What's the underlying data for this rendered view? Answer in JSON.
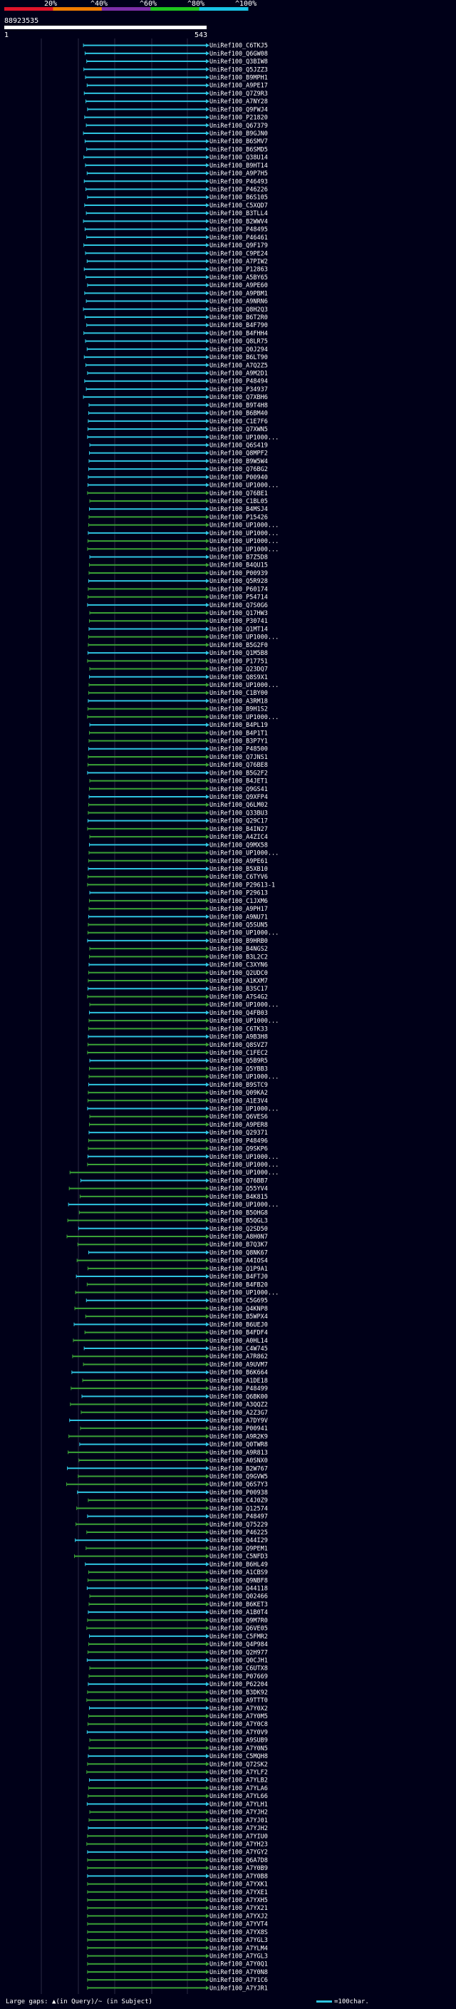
{
  "header": {
    "ruler_ticks": [
      "20%",
      "^40%",
      "^60%",
      "^80%",
      "^100%"
    ],
    "ruler_colors": [
      "#e0142a",
      "#f07b00",
      "#7d2fa8",
      "#1ec41e",
      "#18c3e6"
    ],
    "query_id": "88923535",
    "start_pos": "1",
    "end_pos": "543"
  },
  "colors": {
    "background": "#000018",
    "match_cyan": "#2ec4e0",
    "match_green": "#3aa236",
    "grid": "#2a2a44"
  },
  "footer": {
    "left_text": "Large gaps: ▲(in Query)/~ (in Subject)",
    "right_text": "=100char."
  },
  "chart_data": {
    "type": "alignment",
    "query_length": 543,
    "labels": [
      "UniRef100_C6TKJ5",
      "UniRef100_Q6GW08",
      "UniRef100_Q3BIW8",
      "UniRef100_Q5JZZ3",
      "UniRef100_B9MPH1",
      "UniRef100_A9PE17",
      "UniRef100_Q7Z9R3",
      "UniRef100_A7NY28",
      "UniRef100_Q9FWJ4",
      "UniRef100_P21820",
      "UniRef100_Q67379",
      "UniRef100_B9GJN0",
      "UniRef100_B6SMV7",
      "UniRef100_B6SMD5",
      "UniRef100_Q38U14",
      "UniRef100_B9HT14",
      "UniRef100_A9P7H5",
      "UniRef100_P46493",
      "UniRef100_P46226",
      "UniRef100_B6S105",
      "UniRef100_C5XQD7",
      "UniRef100_B3TLL4",
      "UniRef100_B2WWV4",
      "UniRef100_P48495",
      "UniRef100_P46461",
      "UniRef100_Q9F179",
      "UniRef100_C9PE24",
      "UniRef100_A7PIW2",
      "UniRef100_P12863",
      "UniRef100_A5BY65",
      "UniRef100_A9PE60",
      "UniRef100_A9PBM1",
      "UniRef100_A9NRN6",
      "UniRef100_Q8H2Q3",
      "UniRef100_B6T2R0",
      "UniRef100_B4F790",
      "UniRef100_B4FHH4",
      "UniRef100_Q8LR75",
      "UniRef100_Q0J294",
      "UniRef100_B6LT90",
      "UniRef100_A7Q2Z5",
      "UniRef100_A9M2D1",
      "UniRef100_P48494",
      "UniRef100_P34937",
      "UniRef100_Q7XBH6",
      "UniRef100_B9T4H8",
      "UniRef100_B6BM40",
      "UniRef100_C1E7F6",
      "UniRef100_Q7XWN5",
      "UniRef100_UP1000...",
      "UniRef100_Q6S419",
      "UniRef100_Q8MPF2",
      "UniRef100_B9W5W4",
      "UniRef100_Q76BG2",
      "UniRef100_P00940",
      "UniRef100_UP1000...",
      "UniRef100_Q76BE1",
      "UniRef100_C1BL05",
      "UniRef100_B4MSJ4",
      "UniRef100_P15426",
      "UniRef100_UP1000...",
      "UniRef100_UP1000...",
      "UniRef100_UP1000...",
      "UniRef100_UP1000...",
      "UniRef100_B7Z5D8",
      "UniRef100_B4QU15",
      "UniRef100_P00939",
      "UniRef100_Q5R928",
      "UniRef100_P60174",
      "UniRef100_P54714",
      "UniRef100_Q7S0G6",
      "UniRef100_Q17HW3",
      "UniRef100_P30741",
      "UniRef100_Q1MT14",
      "UniRef100_UP1000...",
      "UniRef100_B5G2F0",
      "UniRef100_Q1M5B8",
      "UniRef100_P17751",
      "UniRef100_Q23DQ7",
      "UniRef100_Q8S9X1",
      "UniRef100_UP1000...",
      "UniRef100_C1BY00",
      "UniRef100_A3RM18",
      "UniRef100_B9H1S2",
      "UniRef100_UP1000...",
      "UniRef100_B4PL19",
      "UniRef100_B4P1T1",
      "UniRef100_B3P7Y1",
      "UniRef100_P48500",
      "UniRef100_Q7JNS1",
      "UniRef100_Q76BE8",
      "UniRef100_B5G2F2",
      "UniRef100_B4JET1",
      "UniRef100_Q9GS41",
      "UniRef100_Q9XFP4",
      "UniRef100_Q6LM02",
      "UniRef100_Q33BU3",
      "UniRef100_Q29C17",
      "UniRef100_B4IN27",
      "UniRef100_A4ZIC4",
      "UniRef100_Q9MX58",
      "UniRef100_UP1000...",
      "UniRef100_A9PE61",
      "UniRef100_B5XB10",
      "UniRef100_C6TYV6",
      "UniRef100_P29613-1",
      "UniRef100_P29613",
      "UniRef100_C1JXM6",
      "UniRef100_A9PH17",
      "UniRef100_A9NU71",
      "UniRef100_Q5SUN5",
      "UniRef100_UP1000...",
      "UniRef100_B9HRB0",
      "UniRef100_B4NGS2",
      "UniRef100_B3L2C2",
      "UniRef100_C3XYN6",
      "UniRef100_Q2UDC0",
      "UniRef100_A1KXM7",
      "UniRef100_B3SC17",
      "UniRef100_A7S4G2",
      "UniRef100_UP1000...",
      "UniRef100_Q4FB03",
      "UniRef100_UP1000...",
      "UniRef100_C6TK33",
      "UniRef100_A9B3H8",
      "UniRef100_Q8SVZ7",
      "UniRef100_C1FEC2",
      "UniRef100_Q5B9R5",
      "UniRef100_Q5YBB3",
      "UniRef100_UP1000...",
      "UniRef100_B9STC9",
      "UniRef100_Q09KA2",
      "UniRef100_A1E3V4",
      "UniRef100_UP1000...",
      "UniRef100_Q6VES6",
      "UniRef100_A9PER8",
      "UniRef100_Q29371",
      "UniRef100_P48496",
      "UniRef100_Q9SKP6",
      "UniRef100_UP1000...",
      "UniRef100_UP1000...",
      "UniRef100_UP1000...",
      "UniRef100_Q76BB7",
      "UniRef100_Q55YV4",
      "UniRef100_B4K815",
      "UniRef100_UP1000...",
      "UniRef100_B5OHG8",
      "UniRef100_B5QGL3",
      "UniRef100_Q2SD50",
      "UniRef100_A8H0N7",
      "UniRef100_B7Q3K7",
      "UniRef100_Q8NK67",
      "UniRef100_A4IOS4",
      "UniRef100_Q1P9A1",
      "UniRef100_B4FTJ0",
      "UniRef100_B4FB20",
      "UniRef100_UP1000...",
      "UniRef100_C5G695",
      "UniRef100_Q4KNP8",
      "UniRef100_B5WPX4",
      "UniRef100_B6UEJ0",
      "UniRef100_B4FDF4",
      "UniRef100_A0HL14",
      "UniRef100_C4W745",
      "UniRef100_A7R862",
      "UniRef100_A9UVM7",
      "UniRef100_B6K664",
      "UniRef100_A1DE18",
      "UniRef100_P48499",
      "UniRef100_Q6BK00",
      "UniRef100_A3QQZ2",
      "UniRef100_A2Z3G7",
      "UniRef100_A7DY9V",
      "UniRef100_P00941",
      "UniRef100_A9R2K9",
      "UniRef100_Q0TWR8",
      "UniRef100_A9R813",
      "UniRef100_A0SNX0",
      "UniRef100_B2W767",
      "UniRef100_Q9GVW5",
      "UniRef100_Q6S7Y3",
      "UniRef100_P00938",
      "UniRef100_C4J0Z9",
      "UniRef100_Q12574",
      "UniRef100_P48497",
      "UniRef100_Q75229",
      "UniRef100_P46225",
      "UniRef100_Q44I29",
      "UniRef100_Q9PEM1",
      "UniRef100_C5NFD3",
      "UniRef100_B6HL49",
      "UniRef100_A1CBS9",
      "UniRef100_Q9NBF8",
      "UniRef100_Q44118",
      "UniRef100_Q02466",
      "UniRef100_B6KET3",
      "UniRef100_A1B0T4",
      "UniRef100_Q9M7R0",
      "UniRef100_Q6VE05",
      "UniRef100_C5FMR2",
      "UniRef100_Q4P984",
      "UniRef100_Q2H977",
      "UniRef100_Q0CJH1",
      "UniRef100_C6UTX8",
      "UniRef100_P07669",
      "UniRef100_P62204",
      "UniRef100_B3DK92",
      "UniRef100_A9TTT0",
      "UniRef100_A7Y0X2",
      "UniRef100_A7Y0M5",
      "UniRef100_A7Y0C8",
      "UniRef100_A7Y0V9",
      "UniRef100_A9SUB9",
      "UniRef100_A7Y0N5",
      "UniRef100_C5MQH8",
      "UniRef100_Q72SK2",
      "UniRef100_A7YLF2",
      "UniRef100_A7YLB2",
      "UniRef100_A7YLA6",
      "UniRef100_A7YL66",
      "UniRef100_A7YLH1",
      "UniRef100_A7YJH2",
      "UniRef100_A7YJ01",
      "UniRef100_A7YJH2",
      "UniRef100_A7YIU0",
      "UniRef100_A7YH23",
      "UniRef100_A7YGY2",
      "UniRef100_Q6A7D8",
      "UniRef100_A7Y0B9",
      "UniRef100_A7Y0B8",
      "UniRef100_A7YXK1",
      "UniRef100_A7YXE1",
      "UniRef100_A7YXH5",
      "UniRef100_A7YX21",
      "UniRef100_A7YXJ2",
      "UniRef100_A7YVT4",
      "UniRef100_A7YX8S",
      "UniRef100_A7YGL3",
      "UniRef100_A7YLM4",
      "UniRef100_A7YGL3",
      "UniRef100_A7Y0Q1",
      "UniRef100_A7Y0N8",
      "UniRef100_A7Y1C6",
      "UniRef100_A7YJR1"
    ],
    "x_range": [
      1,
      543
    ]
  }
}
